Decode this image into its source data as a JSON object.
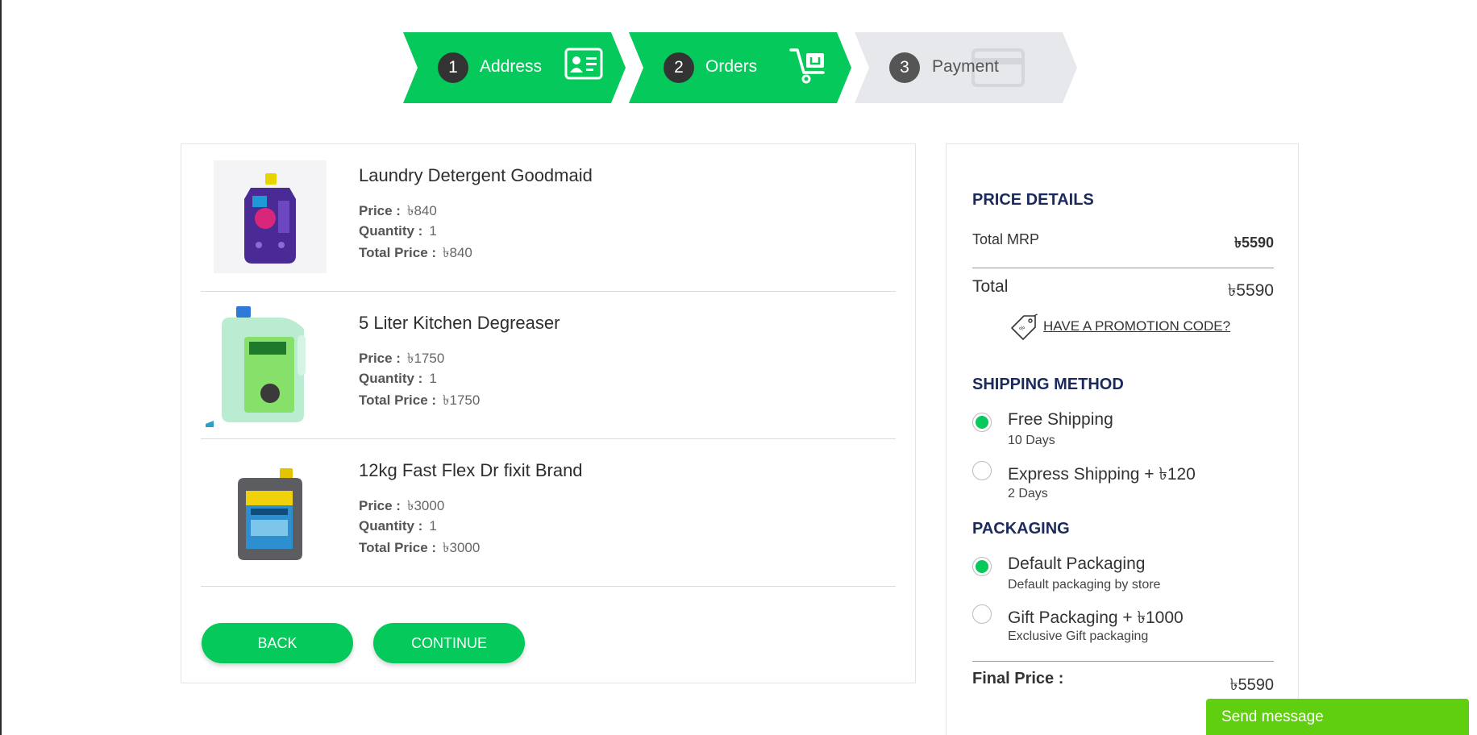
{
  "stepper": {
    "steps": [
      {
        "num": "1",
        "label": "Address",
        "icon": "address-card-icon",
        "state": "done"
      },
      {
        "num": "2",
        "label": "Orders",
        "icon": "cart-icon",
        "state": "done"
      },
      {
        "num": "3",
        "label": "Payment",
        "icon": "credit-card-icon",
        "state": "pending"
      }
    ],
    "active_color": "#05c95a",
    "pending_color": "#e6e8eb"
  },
  "orders": {
    "items": [
      {
        "title": "Laundry Detergent Goodmaid",
        "price_label": "Price :",
        "price": "৳840",
        "qty_label": "Quantity :",
        "qty": "1",
        "total_label": "Total Price :",
        "total": "৳840"
      },
      {
        "title": "5 Liter Kitchen Degreaser",
        "price_label": "Price :",
        "price": "৳1750",
        "qty_label": "Quantity :",
        "qty": "1",
        "total_label": "Total Price :",
        "total": "৳1750"
      },
      {
        "title": "12kg Fast Flex Dr fixit Brand",
        "price_label": "Price :",
        "price": "৳3000",
        "qty_label": "Quantity :",
        "qty": "1",
        "total_label": "Total Price :",
        "total": "৳3000"
      }
    ],
    "back_label": "BACK",
    "continue_label": "CONTINUE"
  },
  "price_details": {
    "heading": "PRICE DETAILS",
    "mrp_label": "Total MRP",
    "mrp_value": "৳5590",
    "total_label": "Total",
    "total_value": "৳5590",
    "promo_label": "HAVE A PROMOTION CODE?",
    "shipping_heading": "SHIPPING METHOD",
    "shipping": [
      {
        "name": "Free Shipping",
        "sub": "10 Days",
        "selected": true
      },
      {
        "name": "Express Shipping + ৳120",
        "sub": "2 Days",
        "selected": false
      }
    ],
    "packaging_heading": "PACKAGING",
    "packaging": [
      {
        "name": "Default Packaging",
        "sub": "Default packaging by store",
        "selected": true
      },
      {
        "name": "Gift Packaging + ৳1000",
        "sub": "Exclusive Gift packaging",
        "selected": false
      }
    ],
    "final_label": "Final Price :",
    "final_value": "৳5590"
  },
  "chat": {
    "label": "Send message"
  }
}
